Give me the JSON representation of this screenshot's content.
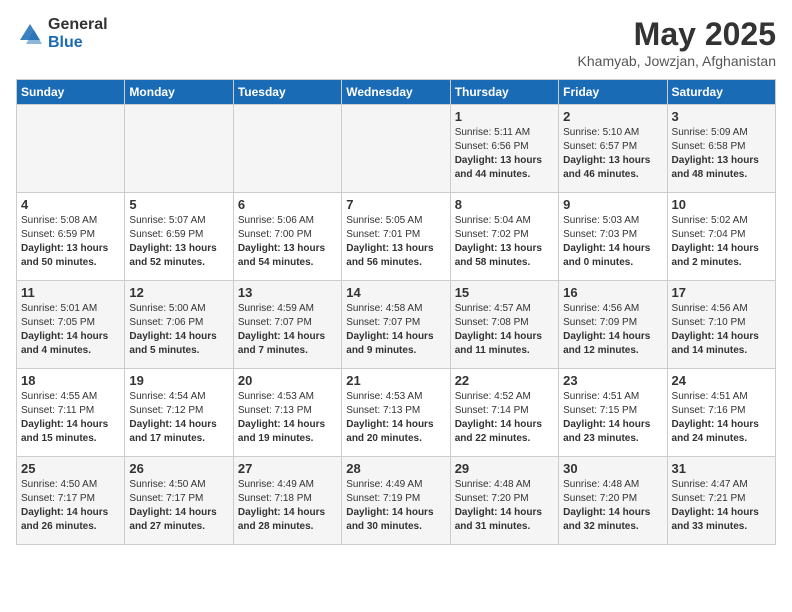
{
  "logo": {
    "general": "General",
    "blue": "Blue"
  },
  "title": "May 2025",
  "location": "Khamyab, Jowzjan, Afghanistan",
  "days_of_week": [
    "Sunday",
    "Monday",
    "Tuesday",
    "Wednesday",
    "Thursday",
    "Friday",
    "Saturday"
  ],
  "weeks": [
    [
      {
        "day": "",
        "sunrise": "",
        "sunset": "",
        "daylight": ""
      },
      {
        "day": "",
        "sunrise": "",
        "sunset": "",
        "daylight": ""
      },
      {
        "day": "",
        "sunrise": "",
        "sunset": "",
        "daylight": ""
      },
      {
        "day": "",
        "sunrise": "",
        "sunset": "",
        "daylight": ""
      },
      {
        "day": "1",
        "sunrise": "5:11 AM",
        "sunset": "6:56 PM",
        "daylight": "13 hours and 44 minutes."
      },
      {
        "day": "2",
        "sunrise": "5:10 AM",
        "sunset": "6:57 PM",
        "daylight": "13 hours and 46 minutes."
      },
      {
        "day": "3",
        "sunrise": "5:09 AM",
        "sunset": "6:58 PM",
        "daylight": "13 hours and 48 minutes."
      }
    ],
    [
      {
        "day": "4",
        "sunrise": "5:08 AM",
        "sunset": "6:59 PM",
        "daylight": "13 hours and 50 minutes."
      },
      {
        "day": "5",
        "sunrise": "5:07 AM",
        "sunset": "6:59 PM",
        "daylight": "13 hours and 52 minutes."
      },
      {
        "day": "6",
        "sunrise": "5:06 AM",
        "sunset": "7:00 PM",
        "daylight": "13 hours and 54 minutes."
      },
      {
        "day": "7",
        "sunrise": "5:05 AM",
        "sunset": "7:01 PM",
        "daylight": "13 hours and 56 minutes."
      },
      {
        "day": "8",
        "sunrise": "5:04 AM",
        "sunset": "7:02 PM",
        "daylight": "13 hours and 58 minutes."
      },
      {
        "day": "9",
        "sunrise": "5:03 AM",
        "sunset": "7:03 PM",
        "daylight": "14 hours and 0 minutes."
      },
      {
        "day": "10",
        "sunrise": "5:02 AM",
        "sunset": "7:04 PM",
        "daylight": "14 hours and 2 minutes."
      }
    ],
    [
      {
        "day": "11",
        "sunrise": "5:01 AM",
        "sunset": "7:05 PM",
        "daylight": "14 hours and 4 minutes."
      },
      {
        "day": "12",
        "sunrise": "5:00 AM",
        "sunset": "7:06 PM",
        "daylight": "14 hours and 5 minutes."
      },
      {
        "day": "13",
        "sunrise": "4:59 AM",
        "sunset": "7:07 PM",
        "daylight": "14 hours and 7 minutes."
      },
      {
        "day": "14",
        "sunrise": "4:58 AM",
        "sunset": "7:07 PM",
        "daylight": "14 hours and 9 minutes."
      },
      {
        "day": "15",
        "sunrise": "4:57 AM",
        "sunset": "7:08 PM",
        "daylight": "14 hours and 11 minutes."
      },
      {
        "day": "16",
        "sunrise": "4:56 AM",
        "sunset": "7:09 PM",
        "daylight": "14 hours and 12 minutes."
      },
      {
        "day": "17",
        "sunrise": "4:56 AM",
        "sunset": "7:10 PM",
        "daylight": "14 hours and 14 minutes."
      }
    ],
    [
      {
        "day": "18",
        "sunrise": "4:55 AM",
        "sunset": "7:11 PM",
        "daylight": "14 hours and 15 minutes."
      },
      {
        "day": "19",
        "sunrise": "4:54 AM",
        "sunset": "7:12 PM",
        "daylight": "14 hours and 17 minutes."
      },
      {
        "day": "20",
        "sunrise": "4:53 AM",
        "sunset": "7:13 PM",
        "daylight": "14 hours and 19 minutes."
      },
      {
        "day": "21",
        "sunrise": "4:53 AM",
        "sunset": "7:13 PM",
        "daylight": "14 hours and 20 minutes."
      },
      {
        "day": "22",
        "sunrise": "4:52 AM",
        "sunset": "7:14 PM",
        "daylight": "14 hours and 22 minutes."
      },
      {
        "day": "23",
        "sunrise": "4:51 AM",
        "sunset": "7:15 PM",
        "daylight": "14 hours and 23 minutes."
      },
      {
        "day": "24",
        "sunrise": "4:51 AM",
        "sunset": "7:16 PM",
        "daylight": "14 hours and 24 minutes."
      }
    ],
    [
      {
        "day": "25",
        "sunrise": "4:50 AM",
        "sunset": "7:17 PM",
        "daylight": "14 hours and 26 minutes."
      },
      {
        "day": "26",
        "sunrise": "4:50 AM",
        "sunset": "7:17 PM",
        "daylight": "14 hours and 27 minutes."
      },
      {
        "day": "27",
        "sunrise": "4:49 AM",
        "sunset": "7:18 PM",
        "daylight": "14 hours and 28 minutes."
      },
      {
        "day": "28",
        "sunrise": "4:49 AM",
        "sunset": "7:19 PM",
        "daylight": "14 hours and 30 minutes."
      },
      {
        "day": "29",
        "sunrise": "4:48 AM",
        "sunset": "7:20 PM",
        "daylight": "14 hours and 31 minutes."
      },
      {
        "day": "30",
        "sunrise": "4:48 AM",
        "sunset": "7:20 PM",
        "daylight": "14 hours and 32 minutes."
      },
      {
        "day": "31",
        "sunrise": "4:47 AM",
        "sunset": "7:21 PM",
        "daylight": "14 hours and 33 minutes."
      }
    ]
  ]
}
